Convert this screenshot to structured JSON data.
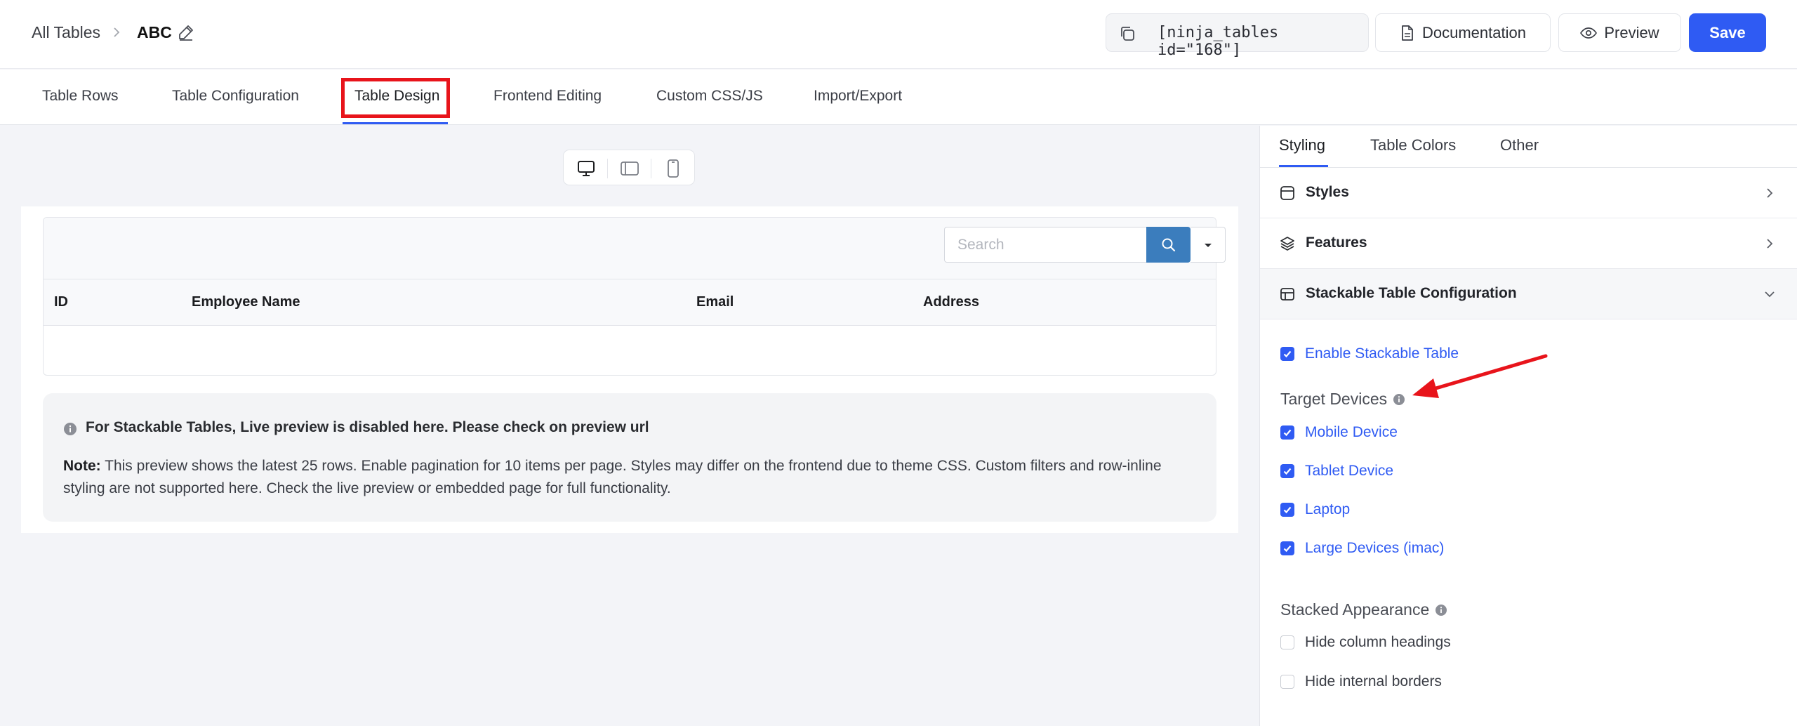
{
  "header": {
    "breadcrumb_root": "All Tables",
    "table_name": "ABC",
    "shortcode": "[ninja_tables id=\"168\"]",
    "documentation_label": "Documentation",
    "preview_label": "Preview",
    "save_label": "Save"
  },
  "tabs": {
    "rows": "Table Rows",
    "configuration": "Table Configuration",
    "design": "Table Design",
    "frontend": "Frontend Editing",
    "css": "Custom CSS/JS",
    "import": "Import/Export"
  },
  "preview": {
    "search_placeholder": "Search",
    "columns": [
      "ID",
      "Employee Name",
      "Email",
      "Address"
    ],
    "notice_headline": "For Stackable Tables, Live preview is disabled here. Please check on preview url",
    "note_label": "Note:",
    "note_text": " This preview shows the latest 25 rows. Enable pagination for 10 items per page. Styles may differ on the frontend due to theme CSS. Custom filters and row-inline styling are not supported here. Check the live preview or embedded page for full functionality."
  },
  "sidebar": {
    "tabs": [
      "Styling",
      "Table Colors",
      "Other"
    ],
    "sections": {
      "styles": "Styles",
      "features": "Features",
      "stackable": "Stackable Table Configuration"
    },
    "enable_stackable": "Enable Stackable Table",
    "target_devices_title": "Target Devices",
    "devices": [
      "Mobile Device",
      "Tablet Device",
      "Laptop",
      "Large Devices (imac)"
    ],
    "stacked_appearance_title": "Stacked Appearance",
    "appearance_options": [
      "Hide column headings",
      "Hide internal borders"
    ]
  },
  "colors": {
    "accent": "#2f5bf3",
    "highlight_box": "#e8141b",
    "search_button": "#3b7dbd"
  }
}
